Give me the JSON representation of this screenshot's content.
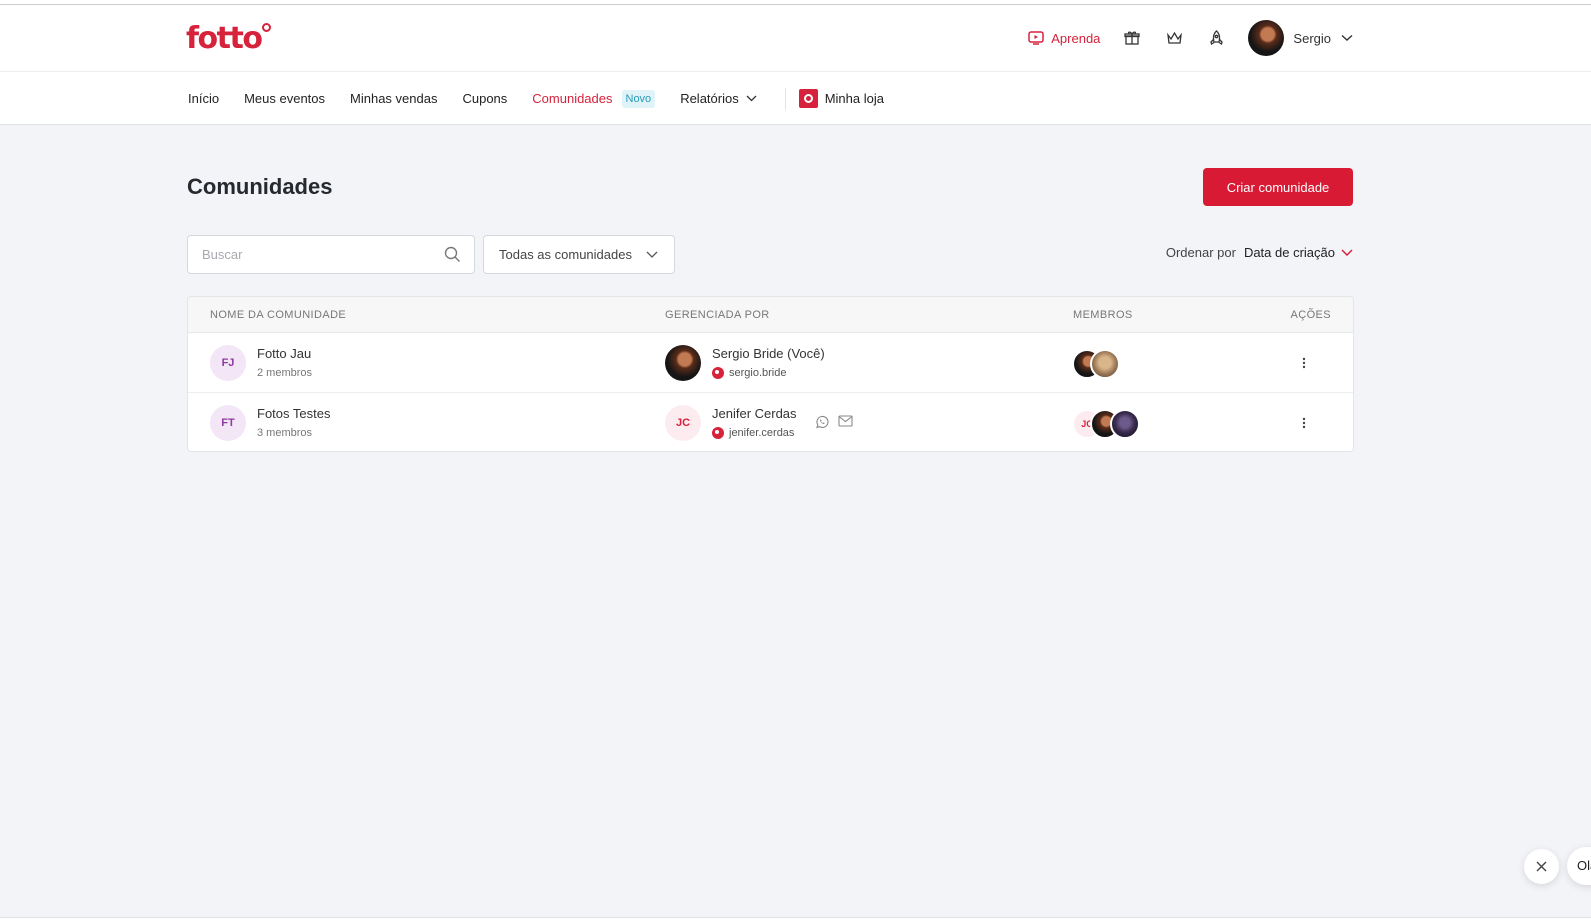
{
  "header": {
    "logo_text": "fotto",
    "learn_label": "Aprenda",
    "icons": [
      "gift-icon",
      "crown-icon",
      "rocket-icon"
    ],
    "user_name": "Sergio"
  },
  "nav": {
    "items": [
      {
        "label": "Início"
      },
      {
        "label": "Meus eventos"
      },
      {
        "label": "Minhas vendas"
      },
      {
        "label": "Cupons"
      },
      {
        "label": "Comunidades",
        "badge": "Novo",
        "active": true
      },
      {
        "label": "Relatórios"
      }
    ],
    "store_label": "Minha loja"
  },
  "page": {
    "title": "Comunidades",
    "create_button": "Criar comunidade"
  },
  "filters": {
    "search_placeholder": "Buscar",
    "community_filter": "Todas as comunidades",
    "sort_label": "Ordenar por",
    "sort_value": "Data de criação"
  },
  "table": {
    "headers": {
      "name": "NOME DA COMUNIDADE",
      "managed_by": "GERENCIADA POR",
      "members": "MEMBROS",
      "actions": "AÇÕES"
    },
    "rows": [
      {
        "initials": "FJ",
        "name": "Fotto Jau",
        "members_count": "2 membros",
        "manager_name": "Sergio Bride (Você)",
        "manager_user": "sergio.bride"
      },
      {
        "initials": "FT",
        "name": "Fotos Testes",
        "members_count": "3 membros",
        "manager_initials": "JC",
        "manager_name": "Jenifer Cerdas",
        "manager_user": "jenifer.cerdas",
        "member_initials": "JC"
      }
    ]
  },
  "chat": {
    "greeting": "Olá"
  },
  "colors": {
    "brand": "#d6223b",
    "background": "#f2f4f8",
    "badge_bg": "#dff3f9",
    "badge_text": "#2a9bb8"
  }
}
